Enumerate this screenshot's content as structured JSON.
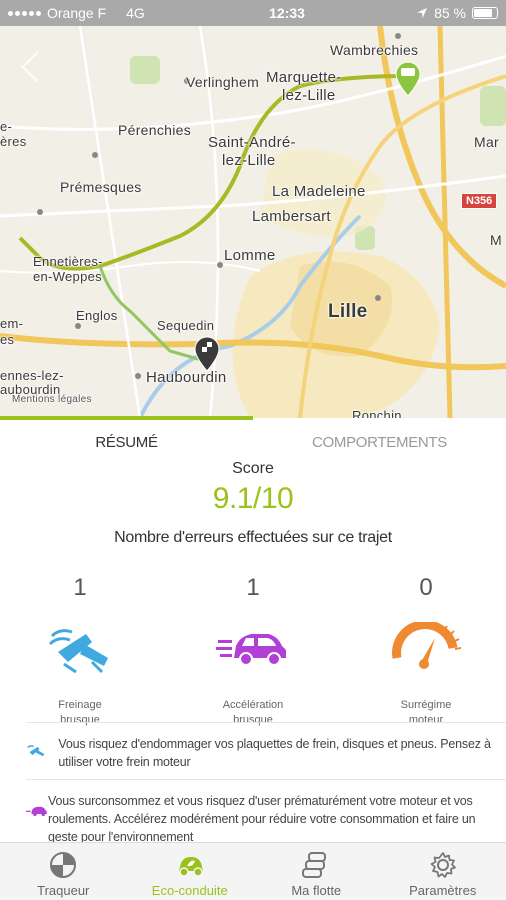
{
  "status_bar": {
    "carrier": "Orange F",
    "network": "4G",
    "time": "12:33",
    "battery": "85 %"
  },
  "map": {
    "labels": {
      "wambrechies": "Wambrechies",
      "verlinghem": "Verlinghem",
      "marquette": "Marquette-",
      "marquette2": "lez-Lille",
      "saint_andre": "Saint-André-",
      "saint_andre2": "lez-Lille",
      "perenchies": "Pérenchies",
      "premesques": "Prémesques",
      "la_madeleine": "La Madeleine",
      "lambersart": "Lambersart",
      "ennetieres": "Ennetières-",
      "ennetieres2": "en-Weppes",
      "lomme": "Lomme",
      "lille": "Lille",
      "englos": "Englos",
      "sequedin": "Sequedin",
      "haubourdin": "Haubourdin",
      "ennes_lez": "ennes-lez-",
      "aubourdin": "aubourdin",
      "mar": "Mar",
      "em": "em-",
      "es": "es",
      "e_left": "e-",
      "eres": "ères",
      "m_right": "M",
      "ronchin": "Ronchin",
      "mentions": "Mentions légales",
      "road_sign": "N356"
    }
  },
  "tabs": {
    "summary": "RÉSUMÉ",
    "behaviors": "COMPORTEMENTS"
  },
  "score": {
    "label": "Score",
    "value": "9.1/10"
  },
  "errors_title": "Nombre d'erreurs effectuées sur ce trajet",
  "stats": [
    {
      "count": "1",
      "label": "Freinage\nbrusque",
      "icon": "braking-icon",
      "color": "#3fa9e0"
    },
    {
      "count": "1",
      "label": "Accélération\nbrusque",
      "icon": "acceleration-icon",
      "color": "#b23fd6"
    },
    {
      "count": "0",
      "label": "Surrégime\nmoteur",
      "icon": "rpm-gauge-icon",
      "color": "#ef8a33"
    }
  ],
  "advice": [
    {
      "text": "Vous risquez d'endommager vos plaquettes de frein, disques et pneus. Pensez à utiliser votre frein moteur"
    },
    {
      "text": "Vous surconsommez et vous risquez d'user prématurément votre moteur et vos roulements. Accélérez modérément pour réduire votre consommation et faire un geste pour l'environnement"
    }
  ],
  "bottom_nav": [
    {
      "label": "Traqueur",
      "icon": "tracker-icon"
    },
    {
      "label": "Eco-conduite",
      "icon": "eco-driving-icon"
    },
    {
      "label": "Ma flotte",
      "icon": "fleet-icon"
    },
    {
      "label": "Paramètres",
      "icon": "settings-gear-icon"
    }
  ],
  "colors": {
    "accent": "#9bc11b",
    "braking": "#3fa9e0",
    "acceleration": "#b23fd6",
    "rpm": "#ef8a33"
  }
}
